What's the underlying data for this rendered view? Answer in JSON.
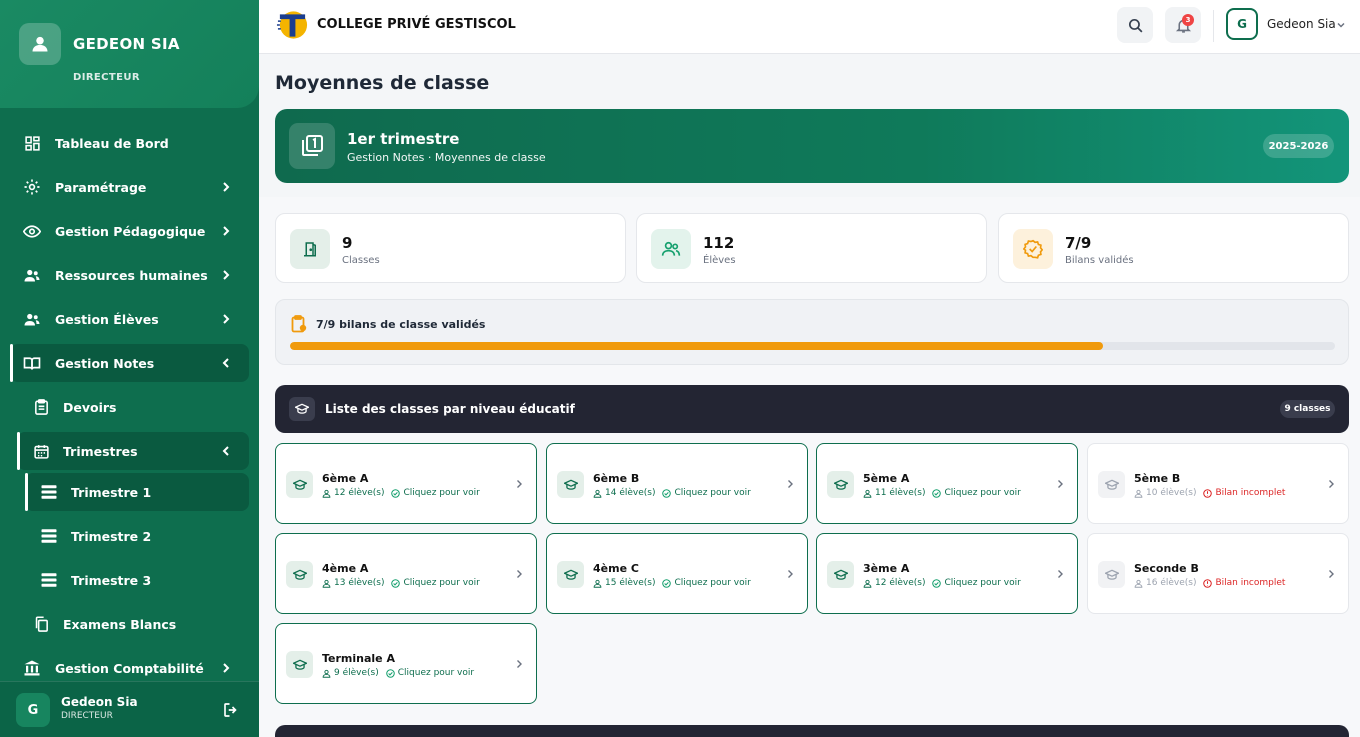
{
  "sidebar": {
    "profile": {
      "name": "GEDEON SIA",
      "role": "DIRECTEUR"
    },
    "items": [
      {
        "label": "Tableau de Bord"
      },
      {
        "label": "Paramétrage"
      },
      {
        "label": "Gestion Pédagogique"
      },
      {
        "label": "Ressources humaines"
      },
      {
        "label": "Gestion Élèves"
      },
      {
        "label": "Gestion Notes"
      },
      {
        "label": "Devoirs"
      },
      {
        "label": "Trimestres"
      },
      {
        "label": "Trimestre 1"
      },
      {
        "label": "Trimestre 2"
      },
      {
        "label": "Trimestre 3"
      },
      {
        "label": "Examens Blancs"
      },
      {
        "label": "Gestion Comptabilité"
      }
    ],
    "footer": {
      "name": "Gedeon Sia",
      "role": "DIRECTEUR",
      "avatar_letter": "G"
    }
  },
  "header": {
    "school_name": "COLLEGE PRIVÉ GESTISCOL",
    "notifications_count": "3",
    "user": {
      "avatar_letter": "G",
      "name": "Gedeon Sia"
    }
  },
  "page": {
    "title": "Moyennes de classe",
    "hero": {
      "title": "1er trimestre",
      "subtitle": "Gestion Notes · Moyennes de classe",
      "year": "2025-2026"
    },
    "stats": [
      {
        "value": "9",
        "label": "Classes"
      },
      {
        "value": "112",
        "label": "Élèves"
      },
      {
        "value": "7/9",
        "label": "Bilans validés"
      }
    ],
    "progress": {
      "label": "7/9 bilans de classe validés",
      "fraction": 0.778
    },
    "class_list": {
      "title": "Liste des classes par niveau éducatif",
      "count": "9 classes",
      "classes": [
        {
          "name": "6ème A",
          "students": "12 élève(s)",
          "status": "Cliquez pour voir"
        },
        {
          "name": "6ème B",
          "students": "14 élève(s)",
          "status": "Cliquez pour voir"
        },
        {
          "name": "5ème A",
          "students": "11 élève(s)",
          "status": "Cliquez pour voir"
        },
        {
          "name": "5ème B",
          "students": "10 élève(s)",
          "status": "Bilan incomplet"
        },
        {
          "name": "4ème A",
          "students": "13 élève(s)",
          "status": "Cliquez pour voir"
        },
        {
          "name": "4ème C",
          "students": "15 élève(s)",
          "status": "Cliquez pour voir"
        },
        {
          "name": "3ème A",
          "students": "12 élève(s)",
          "status": "Cliquez pour voir"
        },
        {
          "name": "Seconde B",
          "students": "16 élève(s)",
          "status": "Bilan incomplet"
        },
        {
          "name": "Terminale A",
          "students": "9 élève(s)",
          "status": "Cliquez pour voir"
        }
      ]
    }
  },
  "colors": {
    "sidebar": "#0e6e4e",
    "accent": "#0e6e4e",
    "progress": "#f09a0c",
    "incomplete": "#dc2626",
    "dark_header": "#232533"
  }
}
